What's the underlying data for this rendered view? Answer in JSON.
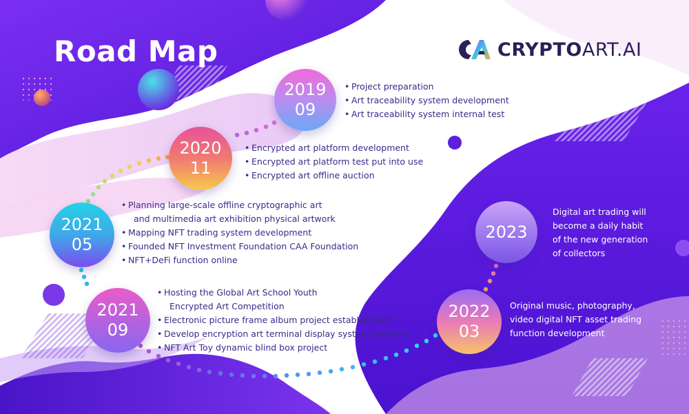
{
  "page": {
    "title": "Road Map"
  },
  "brand": {
    "name_bold": "CRYPTO",
    "name_rest": "ART.AI",
    "logo_icon": "cryptoart-logo-icon"
  },
  "colors": {
    "deep_purple": "#5a1fe0",
    "violet": "#8a3cf0",
    "light_pink": "#f4d8f6",
    "text_dark_purple": "#3a2a8a",
    "node_pink_blue": [
      "#f06ad8",
      "#6aa8f5"
    ],
    "node_orange_magenta": [
      "#e8529a",
      "#f7c94a"
    ],
    "node_cyan_purple": [
      "#23d2e6",
      "#7a4cf0"
    ],
    "node_pink_purple": [
      "#ea5cc8",
      "#8866f2"
    ],
    "node_2022": [
      "#9a6cf4",
      "#f7c26a"
    ],
    "node_2023": [
      "#c9a4f6",
      "#7a55e6"
    ]
  },
  "milestones": [
    {
      "year": "2019",
      "month": "09",
      "items": [
        "Project preparation",
        "Art traceability system development",
        "Art traceability system internal test"
      ]
    },
    {
      "year": "2020",
      "month": "11",
      "items": [
        "Encrypted art platform development",
        "Encrypted art platform test put into use",
        "Encrypted art offline auction"
      ]
    },
    {
      "year": "2021",
      "month": "05",
      "items": [
        "Planning large-scale offline cryptographic art",
        "and  multimedia art exhibition physical artwork",
        "Mapping NFT trading system development",
        "Founded NFT Investment Foundation CAA Foundation",
        "NFT+DeFi function online"
      ]
    },
    {
      "year": "2021",
      "month": "09",
      "items": [
        "Hosting the Global Art School Youth",
        "Encrypted Art Competition",
        "Electronic picture frame album project establishment",
        "Develop encryption art terminal display system software",
        "NFT Art Toy dynamic blind box project"
      ]
    },
    {
      "year": "2022",
      "month": "03",
      "text": "Original music, photography,\nvideo digital NFT asset trading\nfunction development"
    },
    {
      "year": "2023",
      "text": "Digital art trading will\nbecome a daily habit\nof the new generation\nof collectors"
    }
  ]
}
